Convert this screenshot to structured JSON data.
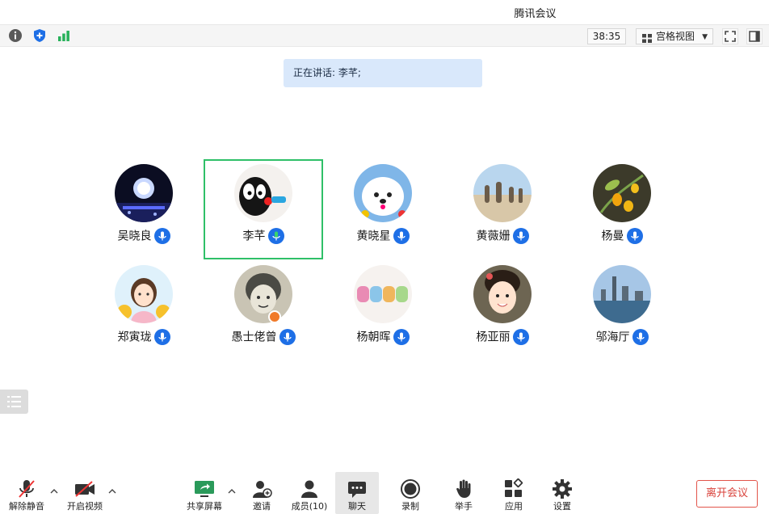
{
  "window": {
    "title": "腾讯会议"
  },
  "infobar": {
    "icons": [
      "info-icon",
      "shield-icon",
      "signal-icon"
    ],
    "timer": "38:35",
    "view_mode": "宫格视图"
  },
  "speaking": {
    "text": "正在讲话: 李芊;"
  },
  "participants": [
    {
      "name": "吴晓良",
      "avatar": "night-lights-avatar",
      "mic": "mic-on",
      "active": false
    },
    {
      "name": "李芊",
      "avatar": "cartoon-creature-avatar",
      "mic": "mic-speaking",
      "active": true
    },
    {
      "name": "黄晓星",
      "avatar": "white-puppy-avatar",
      "mic": "mic-on",
      "active": false
    },
    {
      "name": "黄薇姗",
      "avatar": "beach-statues-avatar",
      "mic": "mic-on",
      "active": false
    },
    {
      "name": "杨曼",
      "avatar": "yellow-flower-avatar",
      "mic": "mic-on",
      "active": false
    },
    {
      "name": "郑寅珑",
      "avatar": "cartoon-girl-avatar",
      "mic": "mic-on",
      "active": false
    },
    {
      "name": "愚士佬曾",
      "avatar": "sketch-face-avatar",
      "mic": "mic-on",
      "active": false,
      "host": true
    },
    {
      "name": "杨朝晖",
      "avatar": "2022-text-avatar",
      "mic": "mic-on",
      "active": false
    },
    {
      "name": "杨亚丽",
      "avatar": "smiling-girl-avatar",
      "mic": "mic-on",
      "active": false
    },
    {
      "name": "邬海厅",
      "avatar": "city-skyline-avatar",
      "mic": "mic-on",
      "active": false
    }
  ],
  "toolbar": {
    "unmute": "解除静音",
    "start_video": "开启视频",
    "share_screen": "共享屏幕",
    "invite": "邀请",
    "members": "成员(10)",
    "chat": "聊天",
    "record": "录制",
    "raise_hand": "举手",
    "apps": "应用",
    "settings": "设置",
    "leave": "离开会议"
  },
  "colors": {
    "accent": "#1e6fe6",
    "active_border": "#2fc068",
    "leave": "#d9413a",
    "banner": "#d9e8fb"
  }
}
